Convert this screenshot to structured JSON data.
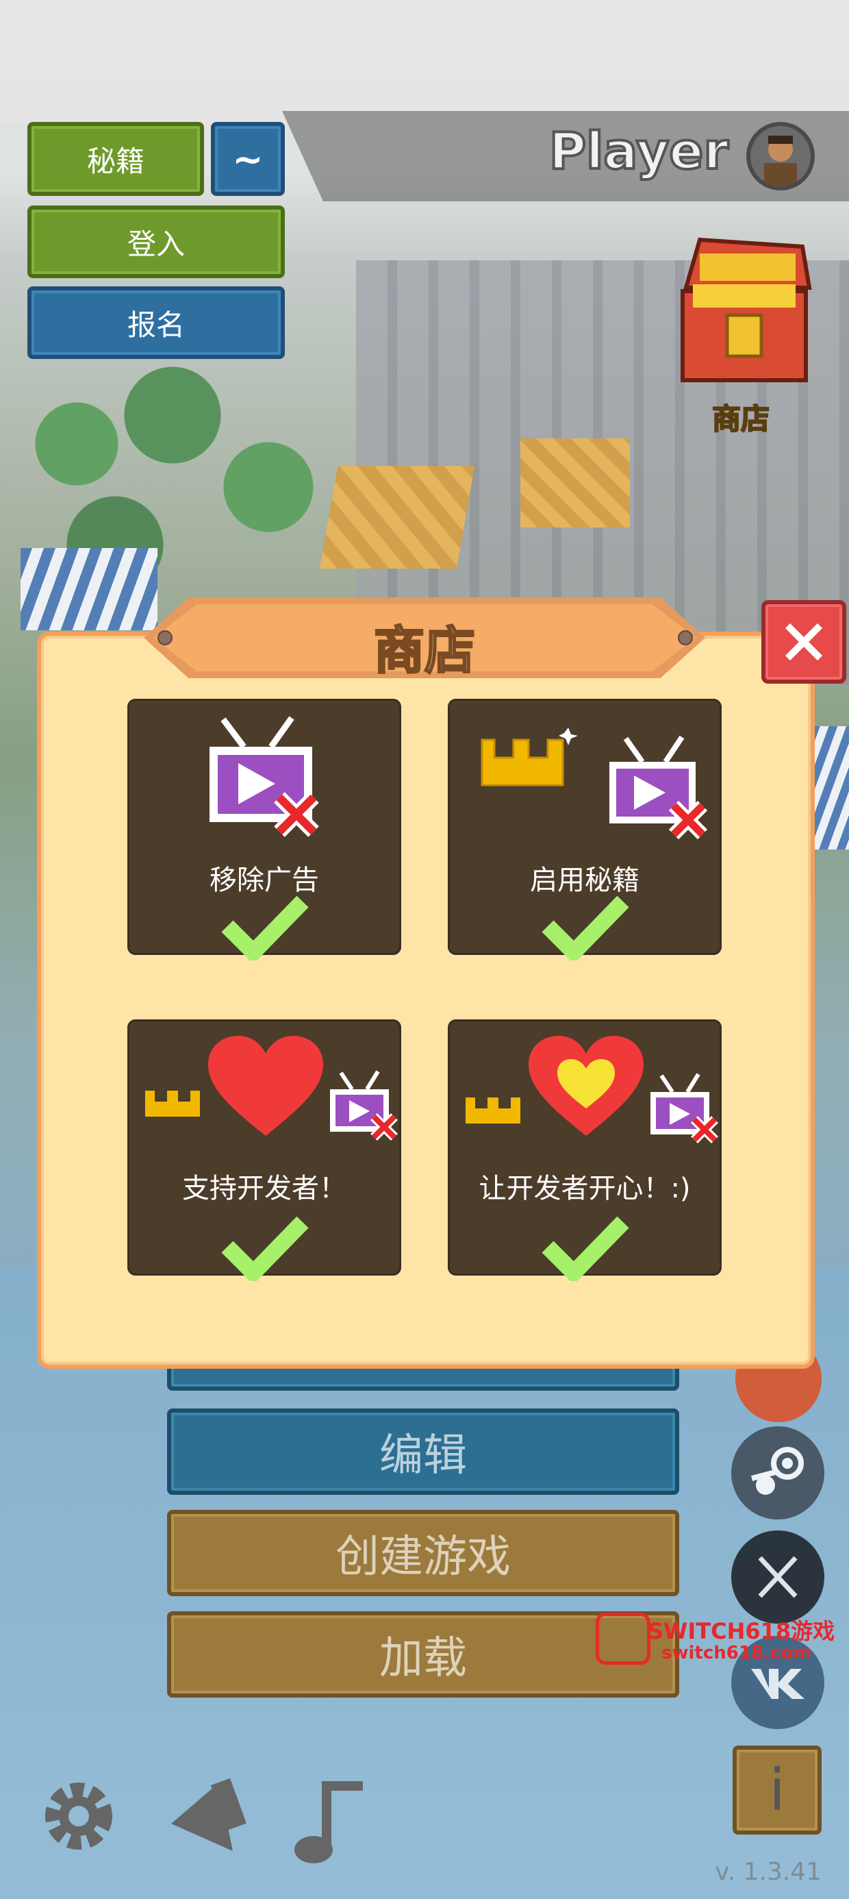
{
  "top_left": {
    "cheats_label": "秘籍",
    "tilde_label": "~",
    "login_label": "登入",
    "signup_label": "报名"
  },
  "player": {
    "name": "Player"
  },
  "shop_shortcut": {
    "label": "商店"
  },
  "modal": {
    "title": "商店",
    "items": [
      {
        "label": "移除广告",
        "icon": "tv-crossed-icon",
        "purchased": true
      },
      {
        "label": "启用秘籍",
        "icon": "crown-tv-crossed-icon",
        "purchased": true
      },
      {
        "label": "支持开发者！",
        "icon": "crown-heart-tv-icon",
        "purchased": true
      },
      {
        "label": "让开发者开心！:)",
        "icon": "crown-heart-tv-smile-icon",
        "purchased": true
      }
    ]
  },
  "menu": {
    "edit_label": "编辑",
    "create_game_label": "创建游戏",
    "load_label": "加载"
  },
  "watermark": {
    "line1": "SWITCH618游戏",
    "line2": "switch618.com"
  },
  "bottom": {
    "info_label": "i",
    "version": "v. 1.3.41"
  },
  "colors": {
    "modal_bg": "#ffe4a8",
    "modal_border": "#f2a15a",
    "tile_bg": "#4c3c2a",
    "check_green": "#a6f06a",
    "close_red": "#e64a4a",
    "cross_red": "#e8282a",
    "tv_purple": "#9b4fc0"
  }
}
